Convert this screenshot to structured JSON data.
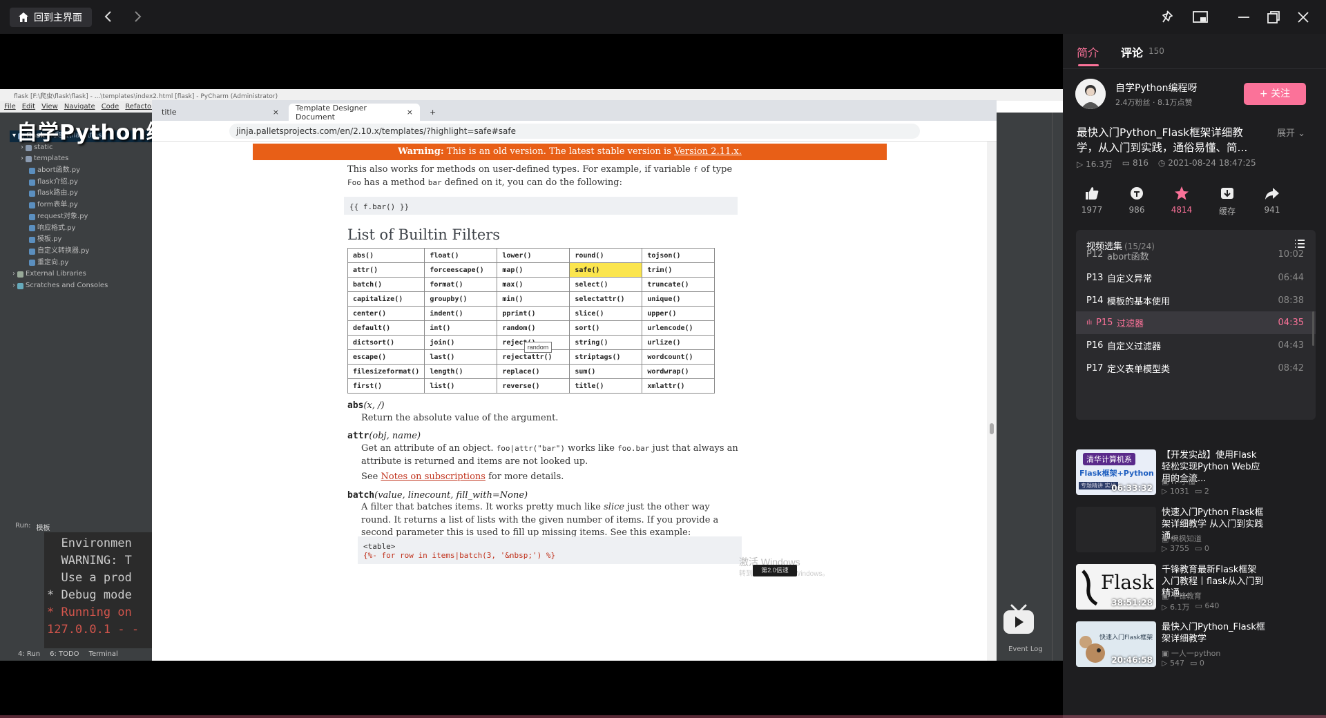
{
  "topbar": {
    "home_label": "回到主界面"
  },
  "video": {
    "overlay_title": "自学Python编程",
    "pycharm": {
      "title": "flask [F:\\爬虫\\flask\\flask] - ...\\templates\\index2.html [flask] - PyCharm (Administrator)",
      "menu": [
        "File",
        "Edit",
        "View",
        "Navigate",
        "Code",
        "Refactor"
      ],
      "project_root": "flask",
      "project_root_path": "F:\\爬虫\\flask\\flask",
      "tree": [
        "static",
        "templates",
        "abort函数.py",
        "flask介绍.py",
        "flask路由.py",
        "form表单.py",
        "request对象.py",
        "响应格式.py",
        "模板.py",
        "自定义转换器.py",
        "重定向.py",
        "External Libraries",
        "Scratches and Consoles"
      ],
      "run_label": "Run:",
      "run_tab": "模板",
      "console": [
        "  Environmen",
        "  WARNING: T",
        "  Use a prod",
        "* Debug mode",
        "* Running on",
        "127.0.0.1 - -"
      ],
      "bottom_tabs": [
        "4: Run",
        "6: TODO",
        "Terminal"
      ],
      "event_log": "Event Log"
    },
    "browser": {
      "tab1": "title",
      "tab2": "Template Designer Document",
      "url": "jinja.palletsprojects.com/en/2.10.x/templates/?highlight=safe#safe",
      "warning_label": "Warning:",
      "warning_text": "This is an old version. The latest stable version is",
      "warning_link": "Version 2.11.x.",
      "intro_1": "This also works for methods on user-defined types. For example, if variable",
      "intro_f": "f",
      "intro_2": "of type",
      "intro_foo": "Foo",
      "intro_3": "has a method",
      "intro_bar": "bar",
      "intro_4": "defined on it, you can do the following:",
      "code1": "{{ f.bar() }}",
      "heading": "List of Builtin Filters",
      "filters": [
        [
          "abs()",
          "float()",
          "lower()",
          "round()",
          "tojson()"
        ],
        [
          "attr()",
          "forceescape()",
          "map()",
          "safe()",
          "trim()"
        ],
        [
          "batch()",
          "format()",
          "max()",
          "select()",
          "truncate()"
        ],
        [
          "capitalize()",
          "groupby()",
          "min()",
          "selectattr()",
          "unique()"
        ],
        [
          "center()",
          "indent()",
          "pprint()",
          "slice()",
          "upper()"
        ],
        [
          "default()",
          "int()",
          "random()",
          "sort()",
          "urlencode()"
        ],
        [
          "dictsort()",
          "join()",
          "reject()",
          "string()",
          "urlize()"
        ],
        [
          "escape()",
          "last()",
          "rejectattr()",
          "striptags()",
          "wordcount()"
        ],
        [
          "filesizeformat()",
          "length()",
          "replace()",
          "sum()",
          "wordwrap()"
        ],
        [
          "first()",
          "list()",
          "reverse()",
          "title()",
          "xmlattr()"
        ]
      ],
      "tooltip": "random",
      "abs_name": "abs",
      "abs_args": "(x, /)",
      "abs_desc": "Return the absolute value of the argument.",
      "attr_name": "attr",
      "attr_args": "(obj, name)",
      "attr_desc_1": "Get an attribute of an object.",
      "attr_code_1": "foo|attr(\"bar\")",
      "attr_desc_2": "works like",
      "attr_code_2": "foo.bar",
      "attr_desc_3": "just that always an attribute is returned and items are not looked up.",
      "attr_see": "See",
      "attr_link": "Notes on subscriptions",
      "attr_see_tail": "for more details.",
      "batch_name": "batch",
      "batch_args": "(value, linecount, fill_with=None)",
      "batch_desc_1": "A filter that batches items. It works pretty much like",
      "batch_desc_slice": "slice",
      "batch_desc_2": "just the other way round. It returns a list of lists with the given number of items. If you provide a second parameter this is used to fill up missing items. See this example:",
      "code2_line1": "<table>",
      "code2_line2": "{%- for row in items|batch(3, '&nbsp;') %}"
    },
    "watermark": "激活 Windows",
    "watermark_sub": "转到\"设置\"以激活 Windows。",
    "speed_pill": "第2.0倍速"
  },
  "sidebar": {
    "tab_intro": "简介",
    "tab_comments": "评论",
    "comments_count": "150",
    "up_name": "自学Python编程呀",
    "up_stats": "2.4万粉丝 · 8.1万点赞",
    "follow_label": "+ 关注",
    "title": "最快入门Python_Flask框架详细教学，从入门到实践，通俗易懂、简...",
    "expand_label": "展开",
    "views": "16.3万",
    "danmaku": "816",
    "date": "2021-08-24 18:47:25",
    "actions": [
      {
        "icon": "like-icon",
        "count": "1977"
      },
      {
        "icon": "coin-icon",
        "count": "986"
      },
      {
        "icon": "star-icon",
        "count": "4814"
      },
      {
        "icon": "download-icon",
        "label": "缓存"
      },
      {
        "icon": "share-icon",
        "count": "941"
      }
    ],
    "accent": "#fb7299",
    "episodes_label": "视频选集",
    "episodes_count": "(15/24)",
    "episodes": [
      {
        "no": "P12",
        "title": "abort函数",
        "dur": "10:02"
      },
      {
        "no": "P13",
        "title": "自定义异常",
        "dur": "06:44"
      },
      {
        "no": "P14",
        "title": "模板的基本使用",
        "dur": "08:38"
      },
      {
        "no": "P15",
        "title": "过滤器",
        "dur": "04:35"
      },
      {
        "no": "P16",
        "title": "自定义过滤器",
        "dur": "04:43"
      },
      {
        "no": "P17",
        "title": "定义表单模型类",
        "dur": "08:42"
      }
    ],
    "recommendations": [
      {
        "title": "【开发实战】使用Flask轻松实现Python Web应用的全流...",
        "author": "IT-小懂",
        "views": "1031",
        "danmaku": "2",
        "dur": "06:33:32",
        "thumb_top": "清华计算机系",
        "thumb_mid": "Flask框架+Python",
        "thumb_bot": "专题精讲 实战"
      },
      {
        "title": "快速入门Python Flask框架详细教学 从入门到实践 通...",
        "author": "枫枫知道",
        "views": "3755",
        "danmaku": "0",
        "dur": ""
      },
      {
        "title": "千锋教育最新Flask框架入门教程丨flask从入门到精通...",
        "author": "千锋教育",
        "views": "6.1万",
        "danmaku": "640",
        "dur": "38:51:28",
        "thumb_word": "Flask"
      },
      {
        "title": "最快入门Python_Flask框架详细教学",
        "author": "一人一python",
        "views": "547",
        "danmaku": "0",
        "dur": "20:46:58",
        "thumb_word": "快速入门Flask框架"
      }
    ]
  }
}
